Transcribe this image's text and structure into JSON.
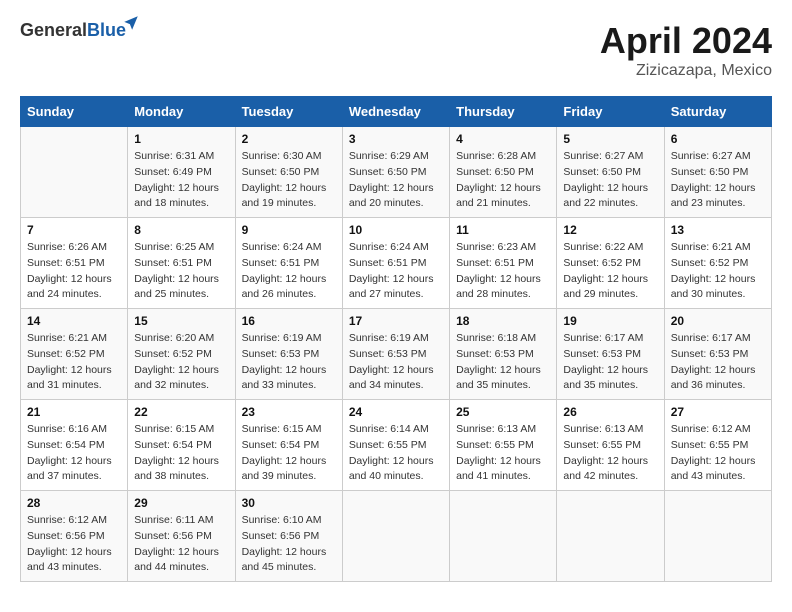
{
  "header": {
    "logo_general": "General",
    "logo_blue": "Blue",
    "month_title": "April 2024",
    "location": "Zizicazapa, Mexico"
  },
  "weekdays": [
    "Sunday",
    "Monday",
    "Tuesday",
    "Wednesday",
    "Thursday",
    "Friday",
    "Saturday"
  ],
  "weeks": [
    [
      {
        "day": "",
        "sunrise": "",
        "sunset": "",
        "daylight": ""
      },
      {
        "day": "1",
        "sunrise": "Sunrise: 6:31 AM",
        "sunset": "Sunset: 6:49 PM",
        "daylight": "Daylight: 12 hours and 18 minutes."
      },
      {
        "day": "2",
        "sunrise": "Sunrise: 6:30 AM",
        "sunset": "Sunset: 6:50 PM",
        "daylight": "Daylight: 12 hours and 19 minutes."
      },
      {
        "day": "3",
        "sunrise": "Sunrise: 6:29 AM",
        "sunset": "Sunset: 6:50 PM",
        "daylight": "Daylight: 12 hours and 20 minutes."
      },
      {
        "day": "4",
        "sunrise": "Sunrise: 6:28 AM",
        "sunset": "Sunset: 6:50 PM",
        "daylight": "Daylight: 12 hours and 21 minutes."
      },
      {
        "day": "5",
        "sunrise": "Sunrise: 6:27 AM",
        "sunset": "Sunset: 6:50 PM",
        "daylight": "Daylight: 12 hours and 22 minutes."
      },
      {
        "day": "6",
        "sunrise": "Sunrise: 6:27 AM",
        "sunset": "Sunset: 6:50 PM",
        "daylight": "Daylight: 12 hours and 23 minutes."
      }
    ],
    [
      {
        "day": "7",
        "sunrise": "Sunrise: 6:26 AM",
        "sunset": "Sunset: 6:51 PM",
        "daylight": "Daylight: 12 hours and 24 minutes."
      },
      {
        "day": "8",
        "sunrise": "Sunrise: 6:25 AM",
        "sunset": "Sunset: 6:51 PM",
        "daylight": "Daylight: 12 hours and 25 minutes."
      },
      {
        "day": "9",
        "sunrise": "Sunrise: 6:24 AM",
        "sunset": "Sunset: 6:51 PM",
        "daylight": "Daylight: 12 hours and 26 minutes."
      },
      {
        "day": "10",
        "sunrise": "Sunrise: 6:24 AM",
        "sunset": "Sunset: 6:51 PM",
        "daylight": "Daylight: 12 hours and 27 minutes."
      },
      {
        "day": "11",
        "sunrise": "Sunrise: 6:23 AM",
        "sunset": "Sunset: 6:51 PM",
        "daylight": "Daylight: 12 hours and 28 minutes."
      },
      {
        "day": "12",
        "sunrise": "Sunrise: 6:22 AM",
        "sunset": "Sunset: 6:52 PM",
        "daylight": "Daylight: 12 hours and 29 minutes."
      },
      {
        "day": "13",
        "sunrise": "Sunrise: 6:21 AM",
        "sunset": "Sunset: 6:52 PM",
        "daylight": "Daylight: 12 hours and 30 minutes."
      }
    ],
    [
      {
        "day": "14",
        "sunrise": "Sunrise: 6:21 AM",
        "sunset": "Sunset: 6:52 PM",
        "daylight": "Daylight: 12 hours and 31 minutes."
      },
      {
        "day": "15",
        "sunrise": "Sunrise: 6:20 AM",
        "sunset": "Sunset: 6:52 PM",
        "daylight": "Daylight: 12 hours and 32 minutes."
      },
      {
        "day": "16",
        "sunrise": "Sunrise: 6:19 AM",
        "sunset": "Sunset: 6:53 PM",
        "daylight": "Daylight: 12 hours and 33 minutes."
      },
      {
        "day": "17",
        "sunrise": "Sunrise: 6:19 AM",
        "sunset": "Sunset: 6:53 PM",
        "daylight": "Daylight: 12 hours and 34 minutes."
      },
      {
        "day": "18",
        "sunrise": "Sunrise: 6:18 AM",
        "sunset": "Sunset: 6:53 PM",
        "daylight": "Daylight: 12 hours and 35 minutes."
      },
      {
        "day": "19",
        "sunrise": "Sunrise: 6:17 AM",
        "sunset": "Sunset: 6:53 PM",
        "daylight": "Daylight: 12 hours and 35 minutes."
      },
      {
        "day": "20",
        "sunrise": "Sunrise: 6:17 AM",
        "sunset": "Sunset: 6:53 PM",
        "daylight": "Daylight: 12 hours and 36 minutes."
      }
    ],
    [
      {
        "day": "21",
        "sunrise": "Sunrise: 6:16 AM",
        "sunset": "Sunset: 6:54 PM",
        "daylight": "Daylight: 12 hours and 37 minutes."
      },
      {
        "day": "22",
        "sunrise": "Sunrise: 6:15 AM",
        "sunset": "Sunset: 6:54 PM",
        "daylight": "Daylight: 12 hours and 38 minutes."
      },
      {
        "day": "23",
        "sunrise": "Sunrise: 6:15 AM",
        "sunset": "Sunset: 6:54 PM",
        "daylight": "Daylight: 12 hours and 39 minutes."
      },
      {
        "day": "24",
        "sunrise": "Sunrise: 6:14 AM",
        "sunset": "Sunset: 6:55 PM",
        "daylight": "Daylight: 12 hours and 40 minutes."
      },
      {
        "day": "25",
        "sunrise": "Sunrise: 6:13 AM",
        "sunset": "Sunset: 6:55 PM",
        "daylight": "Daylight: 12 hours and 41 minutes."
      },
      {
        "day": "26",
        "sunrise": "Sunrise: 6:13 AM",
        "sunset": "Sunset: 6:55 PM",
        "daylight": "Daylight: 12 hours and 42 minutes."
      },
      {
        "day": "27",
        "sunrise": "Sunrise: 6:12 AM",
        "sunset": "Sunset: 6:55 PM",
        "daylight": "Daylight: 12 hours and 43 minutes."
      }
    ],
    [
      {
        "day": "28",
        "sunrise": "Sunrise: 6:12 AM",
        "sunset": "Sunset: 6:56 PM",
        "daylight": "Daylight: 12 hours and 43 minutes."
      },
      {
        "day": "29",
        "sunrise": "Sunrise: 6:11 AM",
        "sunset": "Sunset: 6:56 PM",
        "daylight": "Daylight: 12 hours and 44 minutes."
      },
      {
        "day": "30",
        "sunrise": "Sunrise: 6:10 AM",
        "sunset": "Sunset: 6:56 PM",
        "daylight": "Daylight: 12 hours and 45 minutes."
      },
      {
        "day": "",
        "sunrise": "",
        "sunset": "",
        "daylight": ""
      },
      {
        "day": "",
        "sunrise": "",
        "sunset": "",
        "daylight": ""
      },
      {
        "day": "",
        "sunrise": "",
        "sunset": "",
        "daylight": ""
      },
      {
        "day": "",
        "sunrise": "",
        "sunset": "",
        "daylight": ""
      }
    ]
  ]
}
